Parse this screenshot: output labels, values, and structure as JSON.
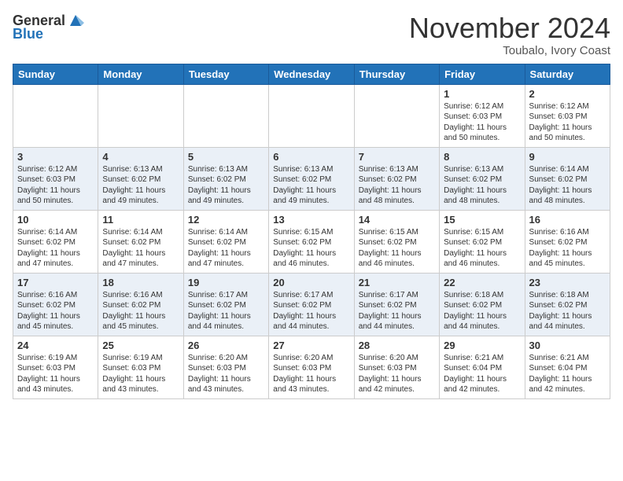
{
  "header": {
    "logo_general": "General",
    "logo_blue": "Blue",
    "month_title": "November 2024",
    "location": "Toubalo, Ivory Coast"
  },
  "days_of_week": [
    "Sunday",
    "Monday",
    "Tuesday",
    "Wednesday",
    "Thursday",
    "Friday",
    "Saturday"
  ],
  "weeks": [
    {
      "days": [
        {
          "num": "",
          "info": ""
        },
        {
          "num": "",
          "info": ""
        },
        {
          "num": "",
          "info": ""
        },
        {
          "num": "",
          "info": ""
        },
        {
          "num": "",
          "info": ""
        },
        {
          "num": "1",
          "info": "Sunrise: 6:12 AM\nSunset: 6:03 PM\nDaylight: 11 hours\nand 50 minutes."
        },
        {
          "num": "2",
          "info": "Sunrise: 6:12 AM\nSunset: 6:03 PM\nDaylight: 11 hours\nand 50 minutes."
        }
      ]
    },
    {
      "days": [
        {
          "num": "3",
          "info": "Sunrise: 6:12 AM\nSunset: 6:03 PM\nDaylight: 11 hours\nand 50 minutes."
        },
        {
          "num": "4",
          "info": "Sunrise: 6:13 AM\nSunset: 6:02 PM\nDaylight: 11 hours\nand 49 minutes."
        },
        {
          "num": "5",
          "info": "Sunrise: 6:13 AM\nSunset: 6:02 PM\nDaylight: 11 hours\nand 49 minutes."
        },
        {
          "num": "6",
          "info": "Sunrise: 6:13 AM\nSunset: 6:02 PM\nDaylight: 11 hours\nand 49 minutes."
        },
        {
          "num": "7",
          "info": "Sunrise: 6:13 AM\nSunset: 6:02 PM\nDaylight: 11 hours\nand 48 minutes."
        },
        {
          "num": "8",
          "info": "Sunrise: 6:13 AM\nSunset: 6:02 PM\nDaylight: 11 hours\nand 48 minutes."
        },
        {
          "num": "9",
          "info": "Sunrise: 6:14 AM\nSunset: 6:02 PM\nDaylight: 11 hours\nand 48 minutes."
        }
      ]
    },
    {
      "days": [
        {
          "num": "10",
          "info": "Sunrise: 6:14 AM\nSunset: 6:02 PM\nDaylight: 11 hours\nand 47 minutes."
        },
        {
          "num": "11",
          "info": "Sunrise: 6:14 AM\nSunset: 6:02 PM\nDaylight: 11 hours\nand 47 minutes."
        },
        {
          "num": "12",
          "info": "Sunrise: 6:14 AM\nSunset: 6:02 PM\nDaylight: 11 hours\nand 47 minutes."
        },
        {
          "num": "13",
          "info": "Sunrise: 6:15 AM\nSunset: 6:02 PM\nDaylight: 11 hours\nand 46 minutes."
        },
        {
          "num": "14",
          "info": "Sunrise: 6:15 AM\nSunset: 6:02 PM\nDaylight: 11 hours\nand 46 minutes."
        },
        {
          "num": "15",
          "info": "Sunrise: 6:15 AM\nSunset: 6:02 PM\nDaylight: 11 hours\nand 46 minutes."
        },
        {
          "num": "16",
          "info": "Sunrise: 6:16 AM\nSunset: 6:02 PM\nDaylight: 11 hours\nand 45 minutes."
        }
      ]
    },
    {
      "days": [
        {
          "num": "17",
          "info": "Sunrise: 6:16 AM\nSunset: 6:02 PM\nDaylight: 11 hours\nand 45 minutes."
        },
        {
          "num": "18",
          "info": "Sunrise: 6:16 AM\nSunset: 6:02 PM\nDaylight: 11 hours\nand 45 minutes."
        },
        {
          "num": "19",
          "info": "Sunrise: 6:17 AM\nSunset: 6:02 PM\nDaylight: 11 hours\nand 44 minutes."
        },
        {
          "num": "20",
          "info": "Sunrise: 6:17 AM\nSunset: 6:02 PM\nDaylight: 11 hours\nand 44 minutes."
        },
        {
          "num": "21",
          "info": "Sunrise: 6:17 AM\nSunset: 6:02 PM\nDaylight: 11 hours\nand 44 minutes."
        },
        {
          "num": "22",
          "info": "Sunrise: 6:18 AM\nSunset: 6:02 PM\nDaylight: 11 hours\nand 44 minutes."
        },
        {
          "num": "23",
          "info": "Sunrise: 6:18 AM\nSunset: 6:02 PM\nDaylight: 11 hours\nand 44 minutes."
        }
      ]
    },
    {
      "days": [
        {
          "num": "24",
          "info": "Sunrise: 6:19 AM\nSunset: 6:03 PM\nDaylight: 11 hours\nand 43 minutes."
        },
        {
          "num": "25",
          "info": "Sunrise: 6:19 AM\nSunset: 6:03 PM\nDaylight: 11 hours\nand 43 minutes."
        },
        {
          "num": "26",
          "info": "Sunrise: 6:20 AM\nSunset: 6:03 PM\nDaylight: 11 hours\nand 43 minutes."
        },
        {
          "num": "27",
          "info": "Sunrise: 6:20 AM\nSunset: 6:03 PM\nDaylight: 11 hours\nand 43 minutes."
        },
        {
          "num": "28",
          "info": "Sunrise: 6:20 AM\nSunset: 6:03 PM\nDaylight: 11 hours\nand 42 minutes."
        },
        {
          "num": "29",
          "info": "Sunrise: 6:21 AM\nSunset: 6:04 PM\nDaylight: 11 hours\nand 42 minutes."
        },
        {
          "num": "30",
          "info": "Sunrise: 6:21 AM\nSunset: 6:04 PM\nDaylight: 11 hours\nand 42 minutes."
        }
      ]
    }
  ]
}
